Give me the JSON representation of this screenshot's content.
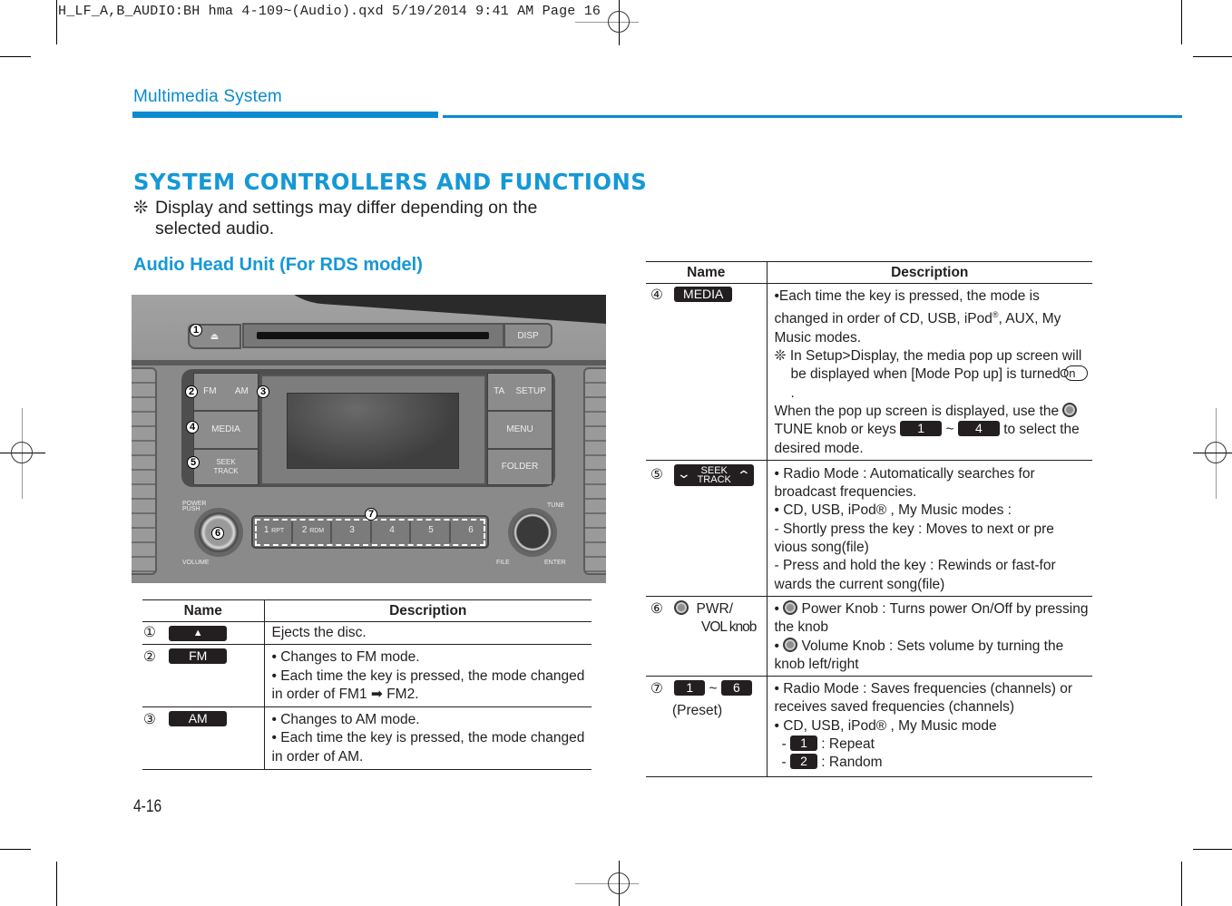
{
  "slug": "H_LF_A,B_AUDIO:BH hma 4-109~(Audio).qxd  5/19/2014  9:41 AM  Page 16",
  "header": {
    "section": "Multimedia System",
    "accent_color": "#0b8ad0"
  },
  "title": "SYSTEM CONTROLLERS AND FUNCTIONS",
  "note": {
    "symbol": "❊",
    "text": "Display and settings may differ depending on the",
    "text_cont": "selected audio."
  },
  "subtitle": "Audio Head Unit (For RDS model)",
  "radio": {
    "eject_symbol": "⏏",
    "disp": "DISP",
    "left_buttons": {
      "fm": "FM",
      "am": "AM",
      "media": "MEDIA",
      "seek": "SEEK",
      "track": "TRACK"
    },
    "right_buttons": {
      "ta": "TA",
      "setup": "SETUP",
      "menu": "MENU",
      "folder": "FOLDER"
    },
    "labels": {
      "power": "POWER",
      "push": "PUSH",
      "volume": "VOLUME",
      "tune": "TUNE",
      "file": "FILE",
      "enter": "ENTER"
    },
    "presets": [
      {
        "num": "1",
        "sub": "RPT"
      },
      {
        "num": "2",
        "sub": "RDM"
      },
      {
        "num": "3",
        "sub": ""
      },
      {
        "num": "4",
        "sub": ""
      },
      {
        "num": "5",
        "sub": ""
      },
      {
        "num": "6",
        "sub": ""
      }
    ],
    "callouts": [
      "1",
      "2",
      "3",
      "4",
      "5",
      "6",
      "7"
    ]
  },
  "table_left": {
    "headers": {
      "name": "Name",
      "description": "Description"
    },
    "rows": [
      {
        "num": "①",
        "key": "▲",
        "desc": [
          "Ejects the disc."
        ]
      },
      {
        "num": "②",
        "key": "FM",
        "desc": [
          "• Changes to FM mode.",
          "• Each time the key is pressed, the mode changed in order of FM1 ➡ FM2."
        ]
      },
      {
        "num": "③",
        "key": "AM",
        "desc": [
          "• Changes to AM mode.",
          "• Each time the key is pressed, the mode changed in order of AM."
        ]
      }
    ]
  },
  "table_right": {
    "headers": {
      "name": "Name",
      "description": "Description"
    },
    "row4": {
      "num": "④",
      "key": "MEDIA",
      "line1": "•Each time the key is pressed, the mode is changed in order of CD, USB, iPod",
      "reg": "®",
      "line1b": ", AUX, My Music modes.",
      "note_sym": "❊",
      "note": "In Setup>Display, the media pop up screen will be displayed when [Mode Pop up] is turned",
      "pill": "On",
      "note_end": ".",
      "line3a": "When the pop up screen is displayed, use the",
      "line3b": "TUNE knob or keys",
      "key_from": "1",
      "tilde": "~",
      "key_to": "4",
      "line3c": "to select the desired mode."
    },
    "row5": {
      "num": "⑤",
      "key_top": "SEEK",
      "key_bottom": "TRACK",
      "lines": [
        "• Radio Mode : Automatically searches for broadcast frequencies.",
        "• CD, USB, iPod® , My Music modes :",
        "- Shortly press the key : Moves to next or pre vious song(file)",
        "- Press and hold the key : Rewinds or fast-for wards the current song(file)"
      ]
    },
    "row6": {
      "num": "⑥",
      "name": "PWR/",
      "name2": "VOL knob",
      "power": "Power Knob : Turns power On/Off by pressing the knob",
      "volume": "Volume Knob : Sets volume by turning the knob left/right"
    },
    "row7": {
      "num": "⑦",
      "key_from": "1",
      "tilde": "~",
      "key_to": "6",
      "sub": "(Preset)",
      "line1": "• Radio Mode : Saves frequencies (channels) or receives saved frequencies (channels)",
      "line2": "• CD, USB, iPod® , My Music mode",
      "repeat_key": "1",
      "repeat": ": Repeat",
      "random_key": "2",
      "random": ": Random"
    }
  },
  "page_number": "4-16"
}
